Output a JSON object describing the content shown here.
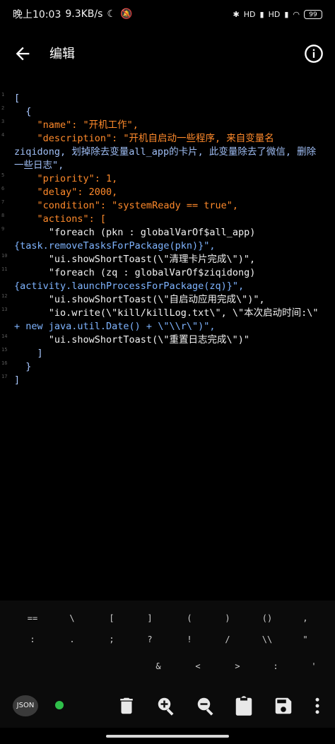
{
  "status_bar": {
    "time": "晚上10:03",
    "speed": "9.3KB/s",
    "right_labels": [
      "HD",
      "HD"
    ],
    "battery": "99"
  },
  "app_bar": {
    "title": "编辑",
    "back_icon": "back-arrow-icon",
    "info_icon": "info-icon"
  },
  "editor": {
    "line_numbers": [
      "1",
      "2",
      "3",
      "4",
      "",
      "",
      "5",
      "6",
      "7",
      "8",
      "9",
      "",
      "10",
      "11",
      "",
      "12",
      "13",
      "",
      "14",
      "15",
      "16",
      "17"
    ],
    "lines": [
      "[",
      "  {",
      "    \"name\": \"开机工作\",",
      "    \"description\": \"开机自启动一些程序, 来自变量名",
      "ziqidong, 划掉除去变量all_app的卡片, 此变量除去了微信, 删除",
      "一些日志\",",
      "    \"priority\": 1,",
      "    \"delay\": 2000,",
      "    \"condition\": \"systemReady == true\",",
      "    \"actions\": [",
      "      \"foreach (pkn : globalVarOf$all_app)",
      "{task.removeTasksForPackage(pkn)}\",",
      "      \"ui.showShortToast(\\\"清理卡片完成\\\")\",",
      "      \"foreach (zq : globalVarOf$ziqidong)",
      "{activity.launchProcessForPackage(zq)}\",",
      "      \"ui.showShortToast(\\\"自启动应用完成\\\")\",",
      "      \"io.write(\\\"kill/killLog.txt\\\", \\\"本次启动时间:\\\"",
      "+ new java.util.Date() + \\\"\\\\r\\\")\",",
      "      \"ui.showShortToast(\\\"重置日志完成\\\")\"",
      "    ]",
      "  }",
      "]"
    ]
  },
  "keyboard": {
    "row1": [
      "==",
      "\\",
      "[",
      "]",
      "(",
      ")",
      "()",
      ","
    ],
    "row2": [
      ":",
      ".",
      ";",
      "?",
      "!",
      "/",
      "\\\\",
      "\""
    ],
    "row3": [
      "&",
      "<",
      ">",
      ":",
      "'"
    ]
  },
  "toolbar": {
    "json_label": "JSON",
    "icons": [
      "delete-icon",
      "zoom-in-icon",
      "zoom-out-icon",
      "paste-icon",
      "save-icon",
      "more-vert-icon"
    ]
  },
  "colors": {
    "background": "#000000",
    "key_orange": "#ff8a2b",
    "number_green": "#4caf7a",
    "token_red": "#ff5d5d",
    "status_dot": "#2fbf4a"
  }
}
